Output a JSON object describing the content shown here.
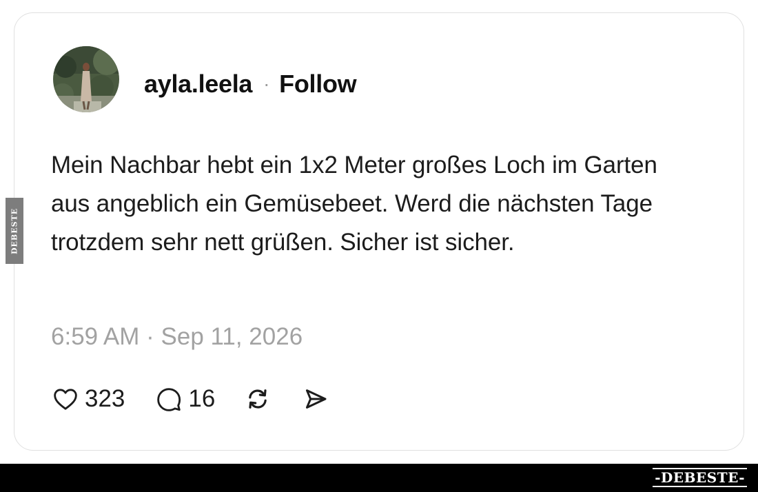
{
  "post": {
    "username": "ayla.leela",
    "separator": "·",
    "follow_label": "Follow",
    "text": "Mein Nachbar hebt ein 1x2 Meter großes Loch im Garten aus angeblich ein Gemüsebeet. Werd die nächsten Tage trotzdem sehr nett grüßen. Sicher ist sicher.",
    "timestamp": "6:59 AM · Sep 11, 2026"
  },
  "actions": {
    "likes": "323",
    "comments": "16",
    "like_icon": "heart-icon",
    "comment_icon": "comment-bubble-icon",
    "repost_icon": "repost-icon",
    "share_icon": "send-icon"
  },
  "watermark": {
    "side_text": "DEBESTE",
    "brand_text": "-DEBESTE-"
  }
}
